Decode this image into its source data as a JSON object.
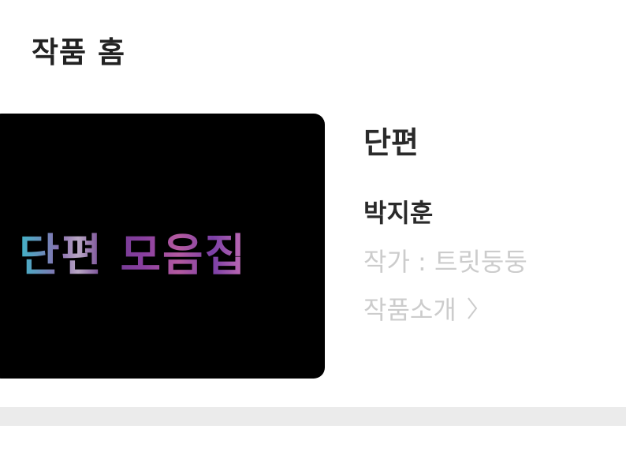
{
  "header": {
    "title": "작품 홈"
  },
  "cover": {
    "text": "단편 모음집"
  },
  "work": {
    "title": "단편",
    "author": "박지훈",
    "writer_label": "작가 : 트릿둥둥",
    "intro_label": "작품소개"
  },
  "icons": {
    "intro_arrow": "chevron-right-icon"
  },
  "colors": {
    "primary_text": "#222222",
    "muted_text": "#cccccc",
    "cover_bg": "#000000",
    "divider": "#ebebeb"
  }
}
